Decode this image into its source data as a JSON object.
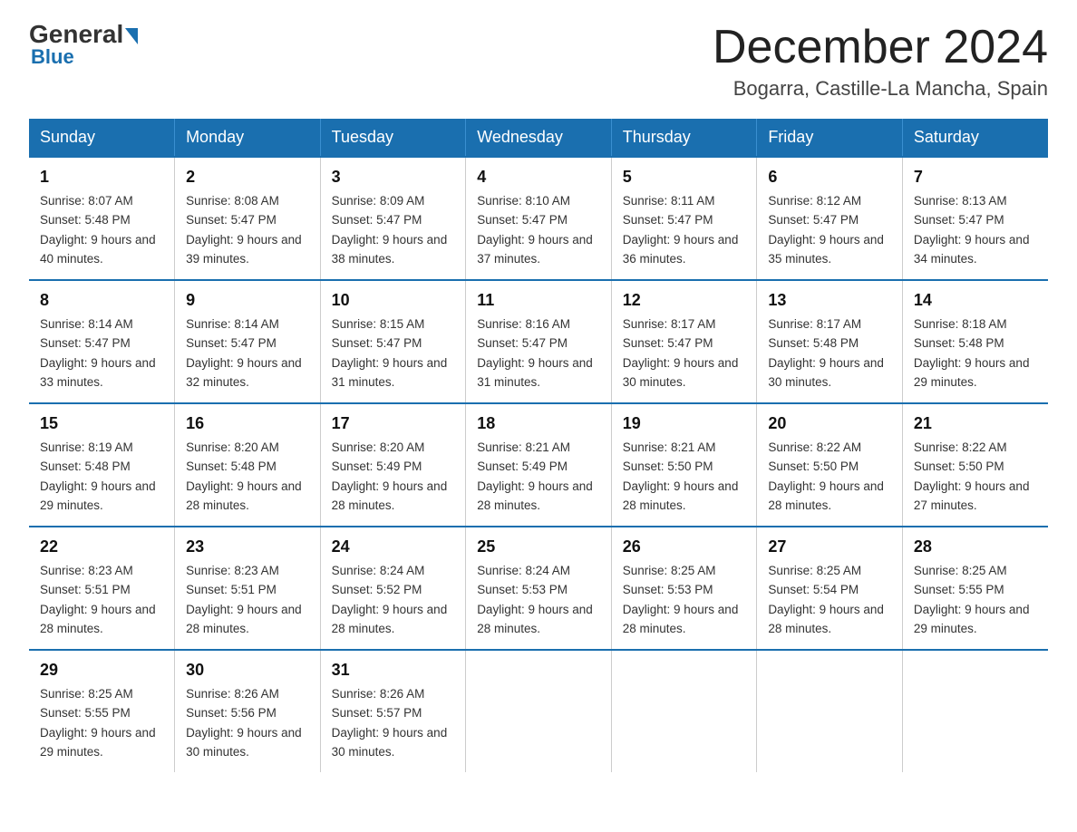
{
  "header": {
    "logo_general": "General",
    "logo_blue": "Blue",
    "calendar_title": "December 2024",
    "calendar_subtitle": "Bogarra, Castille-La Mancha, Spain"
  },
  "days_of_week": [
    "Sunday",
    "Monday",
    "Tuesday",
    "Wednesday",
    "Thursday",
    "Friday",
    "Saturday"
  ],
  "weeks": [
    [
      {
        "day": "1",
        "sunrise": "8:07 AM",
        "sunset": "5:48 PM",
        "daylight": "9 hours and 40 minutes."
      },
      {
        "day": "2",
        "sunrise": "8:08 AM",
        "sunset": "5:47 PM",
        "daylight": "9 hours and 39 minutes."
      },
      {
        "day": "3",
        "sunrise": "8:09 AM",
        "sunset": "5:47 PM",
        "daylight": "9 hours and 38 minutes."
      },
      {
        "day": "4",
        "sunrise": "8:10 AM",
        "sunset": "5:47 PM",
        "daylight": "9 hours and 37 minutes."
      },
      {
        "day": "5",
        "sunrise": "8:11 AM",
        "sunset": "5:47 PM",
        "daylight": "9 hours and 36 minutes."
      },
      {
        "day": "6",
        "sunrise": "8:12 AM",
        "sunset": "5:47 PM",
        "daylight": "9 hours and 35 minutes."
      },
      {
        "day": "7",
        "sunrise": "8:13 AM",
        "sunset": "5:47 PM",
        "daylight": "9 hours and 34 minutes."
      }
    ],
    [
      {
        "day": "8",
        "sunrise": "8:14 AM",
        "sunset": "5:47 PM",
        "daylight": "9 hours and 33 minutes."
      },
      {
        "day": "9",
        "sunrise": "8:14 AM",
        "sunset": "5:47 PM",
        "daylight": "9 hours and 32 minutes."
      },
      {
        "day": "10",
        "sunrise": "8:15 AM",
        "sunset": "5:47 PM",
        "daylight": "9 hours and 31 minutes."
      },
      {
        "day": "11",
        "sunrise": "8:16 AM",
        "sunset": "5:47 PM",
        "daylight": "9 hours and 31 minutes."
      },
      {
        "day": "12",
        "sunrise": "8:17 AM",
        "sunset": "5:47 PM",
        "daylight": "9 hours and 30 minutes."
      },
      {
        "day": "13",
        "sunrise": "8:17 AM",
        "sunset": "5:48 PM",
        "daylight": "9 hours and 30 minutes."
      },
      {
        "day": "14",
        "sunrise": "8:18 AM",
        "sunset": "5:48 PM",
        "daylight": "9 hours and 29 minutes."
      }
    ],
    [
      {
        "day": "15",
        "sunrise": "8:19 AM",
        "sunset": "5:48 PM",
        "daylight": "9 hours and 29 minutes."
      },
      {
        "day": "16",
        "sunrise": "8:20 AM",
        "sunset": "5:48 PM",
        "daylight": "9 hours and 28 minutes."
      },
      {
        "day": "17",
        "sunrise": "8:20 AM",
        "sunset": "5:49 PM",
        "daylight": "9 hours and 28 minutes."
      },
      {
        "day": "18",
        "sunrise": "8:21 AM",
        "sunset": "5:49 PM",
        "daylight": "9 hours and 28 minutes."
      },
      {
        "day": "19",
        "sunrise": "8:21 AM",
        "sunset": "5:50 PM",
        "daylight": "9 hours and 28 minutes."
      },
      {
        "day": "20",
        "sunrise": "8:22 AM",
        "sunset": "5:50 PM",
        "daylight": "9 hours and 28 minutes."
      },
      {
        "day": "21",
        "sunrise": "8:22 AM",
        "sunset": "5:50 PM",
        "daylight": "9 hours and 27 minutes."
      }
    ],
    [
      {
        "day": "22",
        "sunrise": "8:23 AM",
        "sunset": "5:51 PM",
        "daylight": "9 hours and 28 minutes."
      },
      {
        "day": "23",
        "sunrise": "8:23 AM",
        "sunset": "5:51 PM",
        "daylight": "9 hours and 28 minutes."
      },
      {
        "day": "24",
        "sunrise": "8:24 AM",
        "sunset": "5:52 PM",
        "daylight": "9 hours and 28 minutes."
      },
      {
        "day": "25",
        "sunrise": "8:24 AM",
        "sunset": "5:53 PM",
        "daylight": "9 hours and 28 minutes."
      },
      {
        "day": "26",
        "sunrise": "8:25 AM",
        "sunset": "5:53 PM",
        "daylight": "9 hours and 28 minutes."
      },
      {
        "day": "27",
        "sunrise": "8:25 AM",
        "sunset": "5:54 PM",
        "daylight": "9 hours and 28 minutes."
      },
      {
        "day": "28",
        "sunrise": "8:25 AM",
        "sunset": "5:55 PM",
        "daylight": "9 hours and 29 minutes."
      }
    ],
    [
      {
        "day": "29",
        "sunrise": "8:25 AM",
        "sunset": "5:55 PM",
        "daylight": "9 hours and 29 minutes."
      },
      {
        "day": "30",
        "sunrise": "8:26 AM",
        "sunset": "5:56 PM",
        "daylight": "9 hours and 30 minutes."
      },
      {
        "day": "31",
        "sunrise": "8:26 AM",
        "sunset": "5:57 PM",
        "daylight": "9 hours and 30 minutes."
      },
      null,
      null,
      null,
      null
    ]
  ]
}
